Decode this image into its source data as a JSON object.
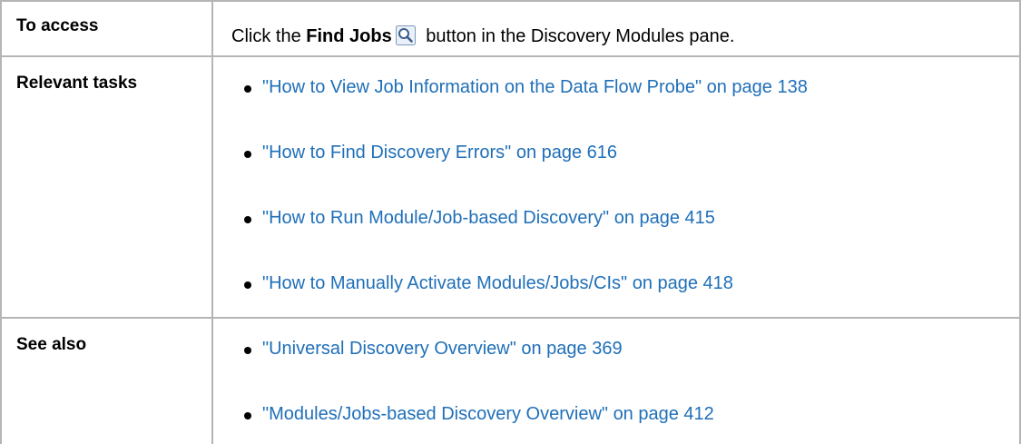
{
  "rows": [
    {
      "label": "To access",
      "access": {
        "prefix": "Click the ",
        "bold": "Find Jobs",
        "icon": "magnifier-icon",
        "suffix": " button in the Discovery Modules pane."
      }
    },
    {
      "label": "Relevant tasks",
      "links": [
        "\"How to View Job Information on the Data Flow Probe\" on page 138",
        "\"How to Find Discovery Errors\" on page 616",
        "\"How to Run Module/Job-based Discovery\" on page 415",
        "\"How to Manually Activate Modules/Jobs/CIs\" on page 418"
      ]
    },
    {
      "label": "See also",
      "links": [
        "\"Universal Discovery Overview\" on page 369",
        "\"Modules/Jobs-based Discovery Overview\" on page 412"
      ]
    }
  ],
  "colors": {
    "border": "#b5b5b5",
    "link": "#1f6fb8"
  }
}
